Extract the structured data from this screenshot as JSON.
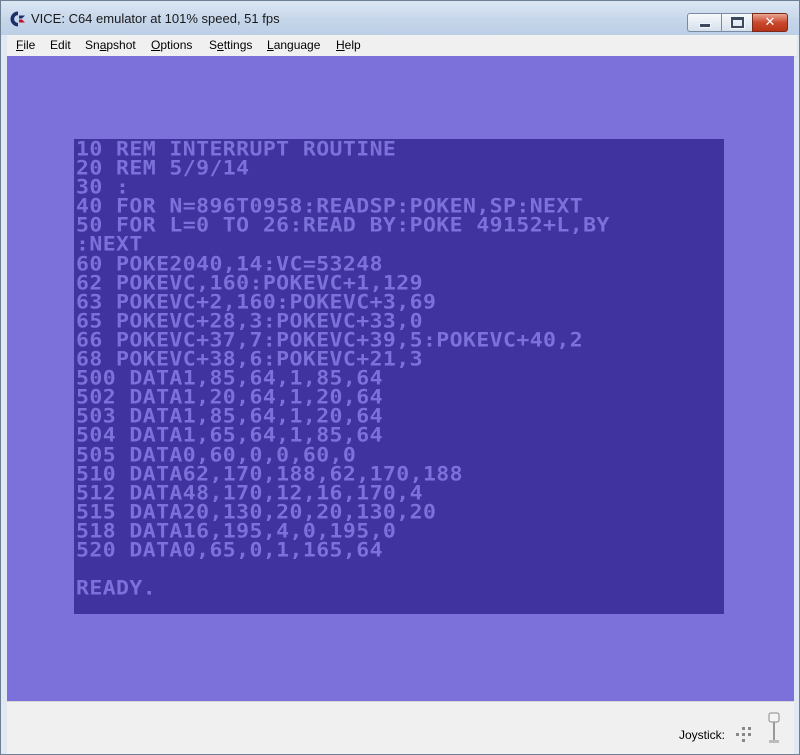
{
  "window": {
    "title": "VICE: C64 emulator at 101% speed, 51 fps"
  },
  "menu": [
    {
      "key": "F",
      "rest": "ile"
    },
    {
      "key": "",
      "pre": "E",
      "rest": "dit"
    },
    {
      "key": "",
      "pre": "Sn",
      "ul": "a",
      "rest": "pshot"
    },
    {
      "key": "O",
      "rest": "ptions"
    },
    {
      "key": "",
      "pre": "S",
      "ul": "e",
      "rest": "ttings"
    },
    {
      "key": "L",
      "rest": "anguage"
    },
    {
      "key": "H",
      "rest": "elp"
    }
  ],
  "menu_labels": [
    "File",
    "Edit",
    "Snapshot",
    "Options",
    "Settings",
    "Language",
    "Help"
  ],
  "screen": {
    "lines": [
      "10 REM INTERRUPT ROUTINE",
      "20 REM 5/9/14",
      "30 :",
      "40 FOR N=896T0958:READSP:POKEN,SP:NEXT",
      "50 FOR L=0 TO 26:READ BY:POKE 49152+L,BY",
      ":NEXT",
      "60 POKE2040,14:VC=53248",
      "62 POKEVC,160:POKEVC+1,129",
      "63 POKEVC+2,160:POKEVC+3,69",
      "65 POKEVC+28,3:POKEVC+33,0",
      "66 POKEVC+37,7:POKEVC+39,5:POKEVC+40,2",
      "68 POKEVC+38,6:POKEVC+21,3",
      "500 DATA1,85,64,1,85,64",
      "502 DATA1,20,64,1,20,64",
      "503 DATA1,85,64,1,20,64",
      "504 DATA1,65,64,1,85,64",
      "505 DATA0,60,0,0,60,0",
      "510 DATA62,170,188,62,170,188",
      "512 DATA48,170,12,16,170,4",
      "515 DATA20,130,20,20,130,20",
      "518 DATA16,195,4,0,195,0",
      "520 DATA0,65,0,1,165,64",
      "",
      "READY."
    ],
    "border_color": "#7c70da",
    "background_color": "#41339f",
    "text_color": "#7c70da"
  },
  "status": {
    "joystick_label": "Joystick:"
  }
}
